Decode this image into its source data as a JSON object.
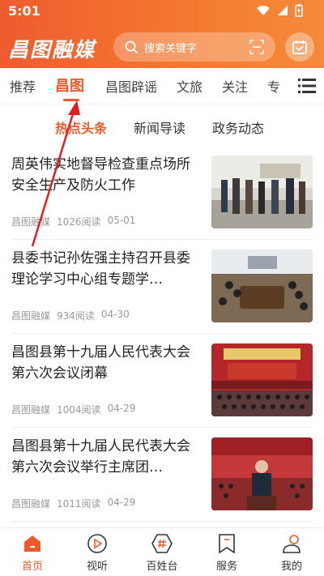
{
  "status_bar": {
    "time": "5:01"
  },
  "header": {
    "logo_text": "昌图融媒",
    "search_placeholder": "搜索关键字"
  },
  "channels": [
    {
      "label": "推荐"
    },
    {
      "label": "昌图",
      "active": true
    },
    {
      "label": "昌图辟谣"
    },
    {
      "label": "文旅"
    },
    {
      "label": "关注"
    },
    {
      "label": "专"
    }
  ],
  "subtabs": [
    {
      "label": "热点头条",
      "active": true
    },
    {
      "label": "新闻导读"
    },
    {
      "label": "政务动态"
    }
  ],
  "news": [
    {
      "title": "周英伟实地督导检查重点场所安全生产及防火工作",
      "source": "昌图融媒",
      "reads": "1026阅读",
      "date": "05-01"
    },
    {
      "title": "县委书记孙佐强主持召开县委理论学习中心组专题学…",
      "source": "昌图融媒",
      "reads": "934阅读",
      "date": "04-30"
    },
    {
      "title": "昌图县第十九届人民代表大会第六次会议闭幕",
      "source": "昌图融媒",
      "reads": "1004阅读",
      "date": "04-29"
    },
    {
      "title": "昌图县第十九届人民代表大会第六次会议举行主席团…",
      "source": "昌图融媒",
      "reads": "1011阅读",
      "date": "04-29"
    }
  ],
  "bottom_nav": [
    {
      "label": "首页",
      "icon": "home-icon",
      "active": true
    },
    {
      "label": "视听",
      "icon": "play-icon"
    },
    {
      "label": "百姓台",
      "icon": "hashtag-icon"
    },
    {
      "label": "服务",
      "icon": "bookmark-icon"
    },
    {
      "label": "我的",
      "icon": "profile-icon"
    }
  ],
  "colors": {
    "accent": "#ea5a2a",
    "header_start": "#ee5b2f",
    "header_end": "#f58a3a"
  }
}
